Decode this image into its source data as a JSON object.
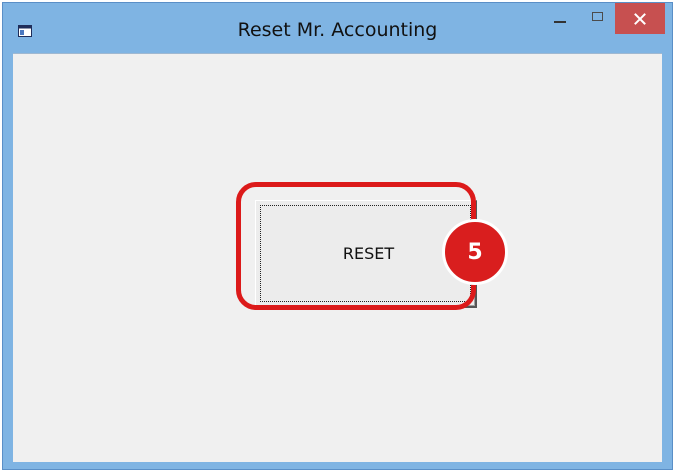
{
  "window": {
    "title": "Reset Mr. Accounting",
    "controls": {
      "minimize_icon": "minimize-icon",
      "maximize_icon": "maximize-icon",
      "close_glyph": "×"
    }
  },
  "main": {
    "reset_button_label": "RESET"
  },
  "annotation": {
    "step_number": "5",
    "highlight_color": "#dc1a1a"
  },
  "colors": {
    "titlebar": "#7fb4e3",
    "client_bg": "#f0f0f0",
    "close_button": "#c75050"
  }
}
